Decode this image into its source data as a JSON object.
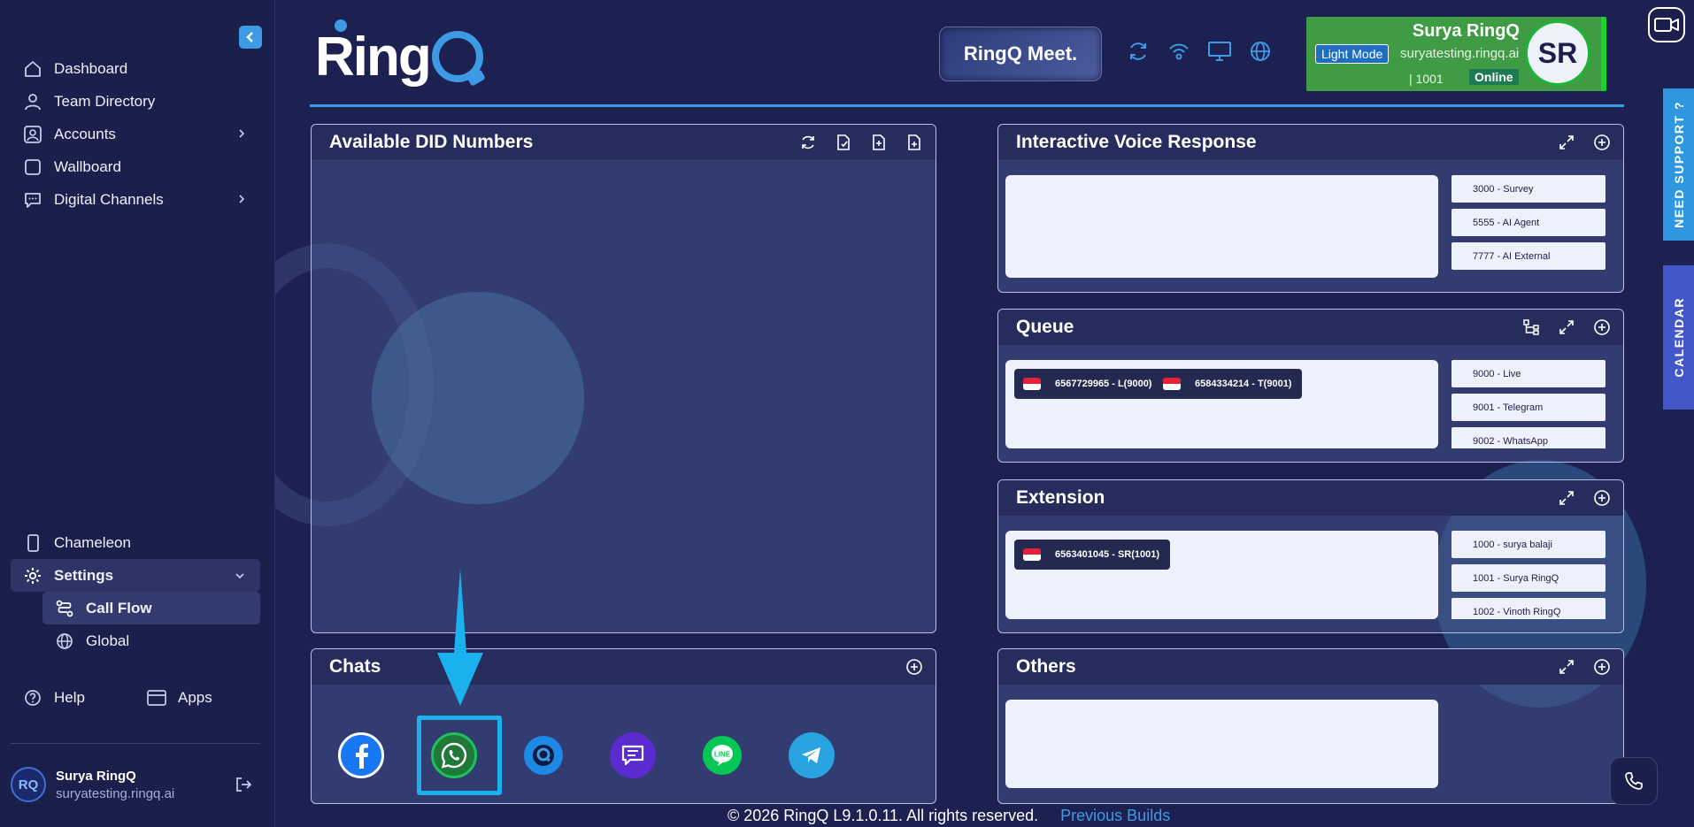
{
  "sidebar": {
    "nav": [
      {
        "label": "Dashboard",
        "icon": "home-icon"
      },
      {
        "label": "Team Directory",
        "icon": "user-icon"
      },
      {
        "label": "Accounts",
        "icon": "account-icon",
        "has_children": true
      },
      {
        "label": "Wallboard",
        "icon": "square-icon"
      },
      {
        "label": "Digital Channels",
        "icon": "chat-bubble-icon",
        "has_children": true
      }
    ],
    "chameleon": "Chameleon",
    "settings": "Settings",
    "call_flow": "Call Flow",
    "global": "Global",
    "help": "Help",
    "apps": "Apps",
    "user": {
      "initials": "RQ",
      "name": "Surya RingQ",
      "email": "suryatesting.ringq.ai"
    }
  },
  "header": {
    "logo": "Ring",
    "meet": "RingQ Meet.",
    "status": {
      "name": "Surya RingQ",
      "mode": "Light Mode",
      "host": "suryatesting.ringq.ai",
      "ext": "| 1001",
      "online": "Online",
      "avatar": "SR"
    }
  },
  "side_tabs": {
    "support": "NEED SUPPORT ?",
    "calendar": "CALENDAR"
  },
  "panels": {
    "did": {
      "title": "Available DID Numbers"
    },
    "ivr": {
      "title": "Interactive Voice Response",
      "items": [
        "3000 - Survey",
        "5555 - AI Agent",
        "7777 - AI External"
      ]
    },
    "queue": {
      "title": "Queue",
      "chips": [
        "6567729965 - L(9000)",
        "6584334214 - T(9001)"
      ],
      "items": [
        "9000 - Live",
        "9001 - Telegram",
        "9002 - WhatsApp"
      ]
    },
    "extension": {
      "title": "Extension",
      "chips": [
        "6563401045 - SR(1001)"
      ],
      "items": [
        "1000 - surya balaji",
        "1001 - Surya RingQ",
        "1002 - Vinoth RingQ"
      ]
    },
    "chats": {
      "title": "Chats",
      "channels": [
        "facebook-icon",
        "whatsapp-icon",
        "ringq-chat-icon",
        "sms-icon",
        "line-icon",
        "telegram-icon"
      ]
    },
    "others": {
      "title": "Others"
    }
  },
  "footer": {
    "copyright": "© 2026 RingQ L9.1.0.11. All rights reserved.",
    "link": "Previous Builds"
  },
  "colors": {
    "accent": "#3d9be6",
    "online": "#3f9b44",
    "highlight": "#1ab1ee"
  }
}
